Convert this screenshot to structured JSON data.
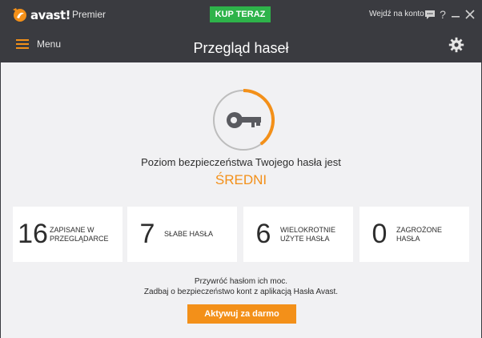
{
  "titlebar": {
    "logo_text": "avast!",
    "edition": "Premier",
    "buy_label": "KUP TERAZ",
    "account_label": "Wejdź na konto",
    "icons": [
      "chat-icon",
      "help-icon",
      "minimize-icon",
      "close-icon"
    ]
  },
  "header": {
    "menu_label": "Menu",
    "title": "Przegląd haseł",
    "settings_icon": "gear-icon"
  },
  "security": {
    "intro": "Poziom bezpieczeństwa Twojego hasła jest",
    "level": "ŚREDNI",
    "gauge_level": 0.4,
    "accent": "#f39019"
  },
  "stats": [
    {
      "value": "16",
      "label": "ZAPISANE W PRZEGLĄDARCE"
    },
    {
      "value": "7",
      "label": "SŁABE HASŁA"
    },
    {
      "value": "6",
      "label": "WIELOKROTNIE UŻYTE HASŁA"
    },
    {
      "value": "0",
      "label": "ZAGROŻONE HASŁA"
    }
  ],
  "promo": {
    "line1": "Przywróć hasłom ich moc.",
    "line2": "Zadbaj o bezpieczeństwo kont z aplikacją Hasła Avast.",
    "cta_label": "Aktywuj za darmo"
  },
  "colors": {
    "buy": "#2eb34a",
    "accent": "#f39019",
    "dark": "#3a3b40"
  }
}
